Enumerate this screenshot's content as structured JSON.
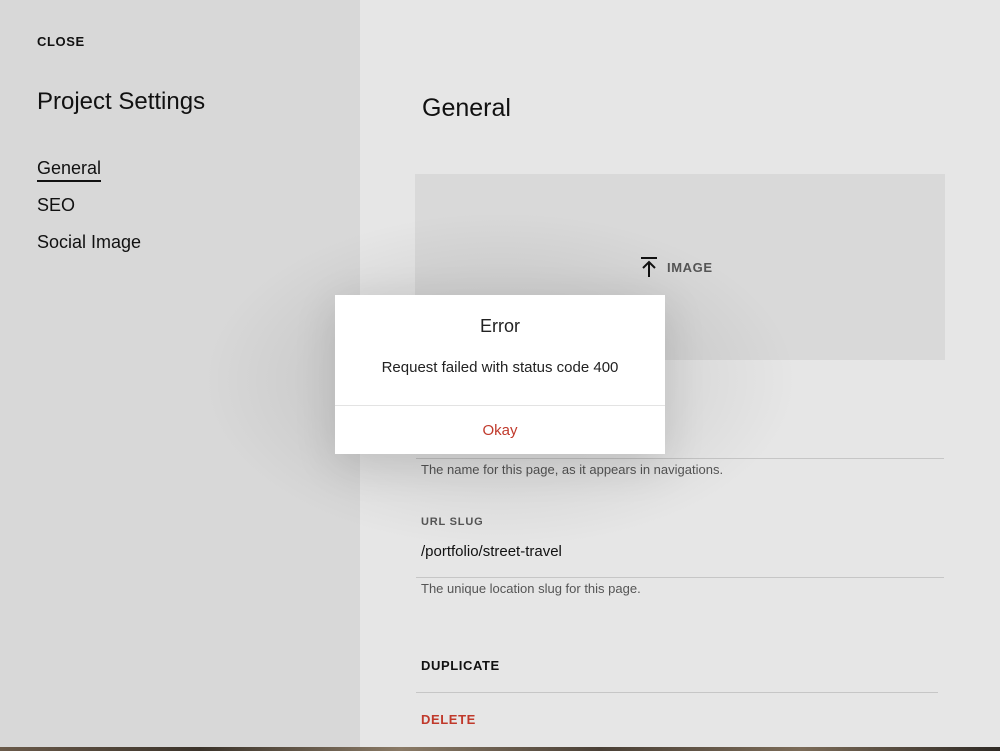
{
  "sidebar": {
    "close_label": "CLOSE",
    "title": "Project Settings",
    "items": [
      {
        "label": "General"
      },
      {
        "label": "SEO"
      },
      {
        "label": "Social Image"
      }
    ]
  },
  "main": {
    "title": "General",
    "image_upload": {
      "label": "IMAGE",
      "icon": "upload-icon"
    },
    "page_title_field": {
      "helper": "The name for this page, as it appears in navigations."
    },
    "url_slug_field": {
      "label": "URL SLUG",
      "value": "/portfolio/street-travel",
      "helper": "The unique location slug for this page."
    },
    "actions": {
      "duplicate_label": "DUPLICATE",
      "delete_label": "DELETE"
    }
  },
  "dialog": {
    "title": "Error",
    "message": "Request failed with status code 400",
    "okay_label": "Okay"
  },
  "colors": {
    "accent_danger": "#c0392b",
    "sidebar_bg": "#d8d8d8",
    "main_bg": "#e6e6e6"
  }
}
